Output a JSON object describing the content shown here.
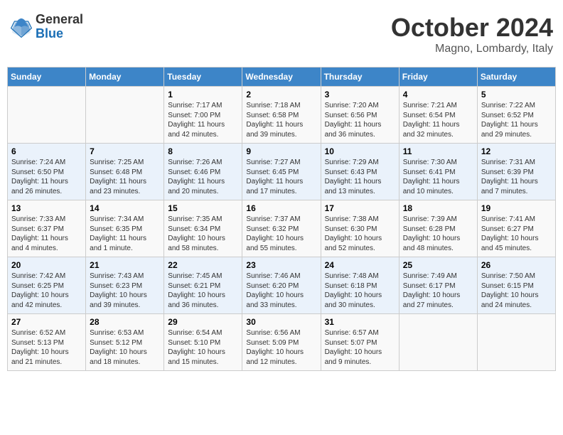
{
  "header": {
    "logo_general": "General",
    "logo_blue": "Blue",
    "month_title": "October 2024",
    "location": "Magno, Lombardy, Italy"
  },
  "days_of_week": [
    "Sunday",
    "Monday",
    "Tuesday",
    "Wednesday",
    "Thursday",
    "Friday",
    "Saturday"
  ],
  "weeks": [
    [
      {
        "day": "",
        "sunrise": "",
        "sunset": "",
        "daylight": ""
      },
      {
        "day": "",
        "sunrise": "",
        "sunset": "",
        "daylight": ""
      },
      {
        "day": "1",
        "sunrise": "Sunrise: 7:17 AM",
        "sunset": "Sunset: 7:00 PM",
        "daylight": "Daylight: 11 hours and 42 minutes."
      },
      {
        "day": "2",
        "sunrise": "Sunrise: 7:18 AM",
        "sunset": "Sunset: 6:58 PM",
        "daylight": "Daylight: 11 hours and 39 minutes."
      },
      {
        "day": "3",
        "sunrise": "Sunrise: 7:20 AM",
        "sunset": "Sunset: 6:56 PM",
        "daylight": "Daylight: 11 hours and 36 minutes."
      },
      {
        "day": "4",
        "sunrise": "Sunrise: 7:21 AM",
        "sunset": "Sunset: 6:54 PM",
        "daylight": "Daylight: 11 hours and 32 minutes."
      },
      {
        "day": "5",
        "sunrise": "Sunrise: 7:22 AM",
        "sunset": "Sunset: 6:52 PM",
        "daylight": "Daylight: 11 hours and 29 minutes."
      }
    ],
    [
      {
        "day": "6",
        "sunrise": "Sunrise: 7:24 AM",
        "sunset": "Sunset: 6:50 PM",
        "daylight": "Daylight: 11 hours and 26 minutes."
      },
      {
        "day": "7",
        "sunrise": "Sunrise: 7:25 AM",
        "sunset": "Sunset: 6:48 PM",
        "daylight": "Daylight: 11 hours and 23 minutes."
      },
      {
        "day": "8",
        "sunrise": "Sunrise: 7:26 AM",
        "sunset": "Sunset: 6:46 PM",
        "daylight": "Daylight: 11 hours and 20 minutes."
      },
      {
        "day": "9",
        "sunrise": "Sunrise: 7:27 AM",
        "sunset": "Sunset: 6:45 PM",
        "daylight": "Daylight: 11 hours and 17 minutes."
      },
      {
        "day": "10",
        "sunrise": "Sunrise: 7:29 AM",
        "sunset": "Sunset: 6:43 PM",
        "daylight": "Daylight: 11 hours and 13 minutes."
      },
      {
        "day": "11",
        "sunrise": "Sunrise: 7:30 AM",
        "sunset": "Sunset: 6:41 PM",
        "daylight": "Daylight: 11 hours and 10 minutes."
      },
      {
        "day": "12",
        "sunrise": "Sunrise: 7:31 AM",
        "sunset": "Sunset: 6:39 PM",
        "daylight": "Daylight: 11 hours and 7 minutes."
      }
    ],
    [
      {
        "day": "13",
        "sunrise": "Sunrise: 7:33 AM",
        "sunset": "Sunset: 6:37 PM",
        "daylight": "Daylight: 11 hours and 4 minutes."
      },
      {
        "day": "14",
        "sunrise": "Sunrise: 7:34 AM",
        "sunset": "Sunset: 6:35 PM",
        "daylight": "Daylight: 11 hours and 1 minute."
      },
      {
        "day": "15",
        "sunrise": "Sunrise: 7:35 AM",
        "sunset": "Sunset: 6:34 PM",
        "daylight": "Daylight: 10 hours and 58 minutes."
      },
      {
        "day": "16",
        "sunrise": "Sunrise: 7:37 AM",
        "sunset": "Sunset: 6:32 PM",
        "daylight": "Daylight: 10 hours and 55 minutes."
      },
      {
        "day": "17",
        "sunrise": "Sunrise: 7:38 AM",
        "sunset": "Sunset: 6:30 PM",
        "daylight": "Daylight: 10 hours and 52 minutes."
      },
      {
        "day": "18",
        "sunrise": "Sunrise: 7:39 AM",
        "sunset": "Sunset: 6:28 PM",
        "daylight": "Daylight: 10 hours and 48 minutes."
      },
      {
        "day": "19",
        "sunrise": "Sunrise: 7:41 AM",
        "sunset": "Sunset: 6:27 PM",
        "daylight": "Daylight: 10 hours and 45 minutes."
      }
    ],
    [
      {
        "day": "20",
        "sunrise": "Sunrise: 7:42 AM",
        "sunset": "Sunset: 6:25 PM",
        "daylight": "Daylight: 10 hours and 42 minutes."
      },
      {
        "day": "21",
        "sunrise": "Sunrise: 7:43 AM",
        "sunset": "Sunset: 6:23 PM",
        "daylight": "Daylight: 10 hours and 39 minutes."
      },
      {
        "day": "22",
        "sunrise": "Sunrise: 7:45 AM",
        "sunset": "Sunset: 6:21 PM",
        "daylight": "Daylight: 10 hours and 36 minutes."
      },
      {
        "day": "23",
        "sunrise": "Sunrise: 7:46 AM",
        "sunset": "Sunset: 6:20 PM",
        "daylight": "Daylight: 10 hours and 33 minutes."
      },
      {
        "day": "24",
        "sunrise": "Sunrise: 7:48 AM",
        "sunset": "Sunset: 6:18 PM",
        "daylight": "Daylight: 10 hours and 30 minutes."
      },
      {
        "day": "25",
        "sunrise": "Sunrise: 7:49 AM",
        "sunset": "Sunset: 6:17 PM",
        "daylight": "Daylight: 10 hours and 27 minutes."
      },
      {
        "day": "26",
        "sunrise": "Sunrise: 7:50 AM",
        "sunset": "Sunset: 6:15 PM",
        "daylight": "Daylight: 10 hours and 24 minutes."
      }
    ],
    [
      {
        "day": "27",
        "sunrise": "Sunrise: 6:52 AM",
        "sunset": "Sunset: 5:13 PM",
        "daylight": "Daylight: 10 hours and 21 minutes."
      },
      {
        "day": "28",
        "sunrise": "Sunrise: 6:53 AM",
        "sunset": "Sunset: 5:12 PM",
        "daylight": "Daylight: 10 hours and 18 minutes."
      },
      {
        "day": "29",
        "sunrise": "Sunrise: 6:54 AM",
        "sunset": "Sunset: 5:10 PM",
        "daylight": "Daylight: 10 hours and 15 minutes."
      },
      {
        "day": "30",
        "sunrise": "Sunrise: 6:56 AM",
        "sunset": "Sunset: 5:09 PM",
        "daylight": "Daylight: 10 hours and 12 minutes."
      },
      {
        "day": "31",
        "sunrise": "Sunrise: 6:57 AM",
        "sunset": "Sunset: 5:07 PM",
        "daylight": "Daylight: 10 hours and 9 minutes."
      },
      {
        "day": "",
        "sunrise": "",
        "sunset": "",
        "daylight": ""
      },
      {
        "day": "",
        "sunrise": "",
        "sunset": "",
        "daylight": ""
      }
    ]
  ]
}
